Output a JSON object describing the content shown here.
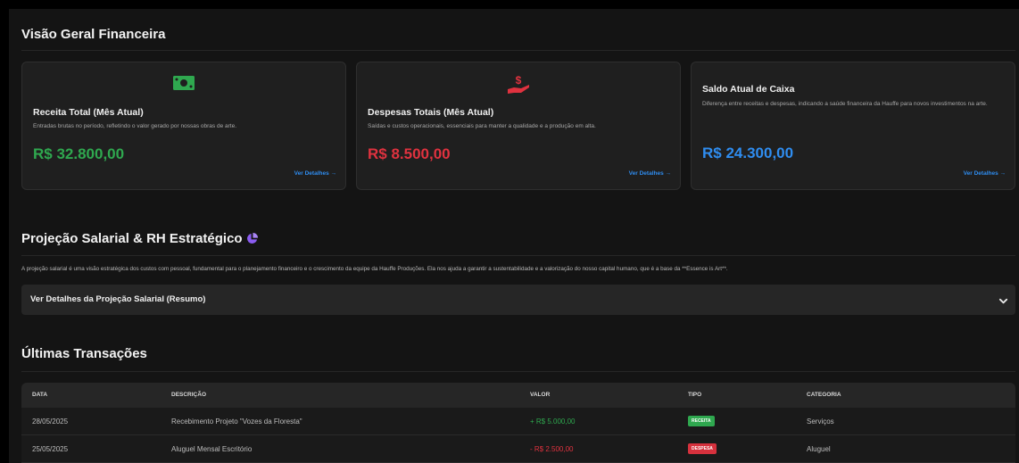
{
  "overview": {
    "title": "Visão Geral Financeira",
    "cards": [
      {
        "icon": "money-bill-icon",
        "title": "Receita Total (Mês Atual)",
        "description": "Entradas brutas no período, refletindo o valor gerado por nossas obras de arte.",
        "value": "R$ 32.800,00",
        "link": "Ver Detalhes →",
        "value_color": "#2fa84f"
      },
      {
        "icon": "hand-dollar-icon",
        "title": "Despesas Totais (Mês Atual)",
        "description": "Saídas e custos operacionais, essenciais para manter a qualidade e a produção em alta.",
        "value": "R$ 8.500,00",
        "link": "Ver Detalhes →",
        "value_color": "#e0323f"
      },
      {
        "title": "Saldo Atual de Caixa",
        "description": "Diferença entre receitas e despesas, indicando a saúde financeira da Hauffe para novos investimentos na arte.",
        "value": "R$ 24.300,00",
        "link": "Ver Detalhes →",
        "value_color": "#2f8df0"
      }
    ]
  },
  "projection": {
    "title": "Projeção Salarial & RH Estratégico",
    "icon": "pie-chart-icon",
    "intro": "A projeção salarial é uma visão estratégica dos custos com pessoal, fundamental para o planejamento financeiro e o crescimento da equipe da Hauffe Produções. Ela nos ajuda a garantir a sustentabilidade e a valorização do nosso capital humano, que é a base da **Essence is Art**.",
    "accordion_title": "Ver Detalhes da Projeção Salarial (Resumo)"
  },
  "transactions": {
    "title": "Últimas Transações",
    "columns": [
      "DATA",
      "DESCRIÇÃO",
      "VALOR",
      "TIPO",
      "CATEGORIA"
    ],
    "rows": [
      {
        "date": "28/05/2025",
        "description": "Recebimento Projeto \"Vozes da Floresta\"",
        "amount": "+ R$ 5.000,00",
        "type": "RECEITA",
        "category": "Serviços"
      },
      {
        "date": "25/05/2025",
        "description": "Aluguel Mensal Escritório",
        "amount": "- R$ 2.500,00",
        "type": "DESPESA",
        "category": "Aluguel"
      }
    ]
  },
  "colors": {
    "income": "#2fa84f",
    "expense": "#e0323f",
    "balance": "#2f8df0",
    "accent_purple": "#8a5cf0"
  }
}
